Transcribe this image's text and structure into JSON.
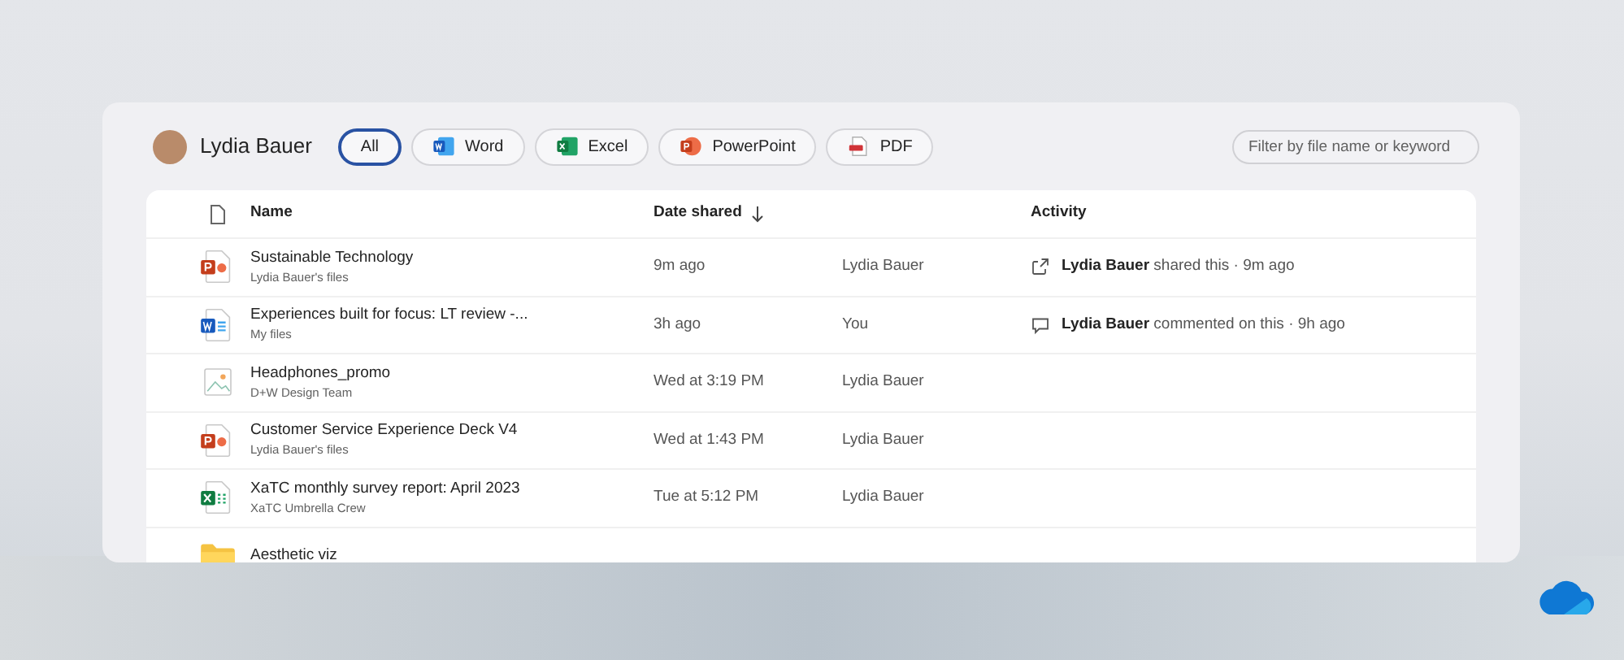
{
  "header": {
    "user_name": "Lydia Bauer"
  },
  "filters": [
    {
      "label": "All",
      "kind": "all",
      "selected": true
    },
    {
      "label": "Word",
      "kind": "word",
      "selected": false
    },
    {
      "label": "Excel",
      "kind": "excel",
      "selected": false
    },
    {
      "label": "PowerPoint",
      "kind": "powerpoint",
      "selected": false
    },
    {
      "label": "PDF",
      "kind": "pdf",
      "selected": false
    }
  ],
  "search": {
    "placeholder": "Filter by file name or keyword"
  },
  "table": {
    "columns": [
      "Name",
      "Date shared",
      "Activity"
    ],
    "rows": [
      {
        "kind": "powerpoint",
        "name": "Sustainable Technology",
        "location": "Lydia Bauer's files",
        "date": "9m ago",
        "shared_by": "Lydia Bauer",
        "activity": {
          "kind": "share",
          "text": "**Lydia Bauer** shared this · 9m ago"
        }
      },
      {
        "kind": "word",
        "name": "Experiences built for focus: LT review -...",
        "location": "My files",
        "date": "3h ago",
        "shared_by": "You",
        "activity": {
          "kind": "comment",
          "text": "**Lydia Bauer** commented on this · 9h ago"
        }
      },
      {
        "kind": "image",
        "name": "Headphones_promo",
        "location": "D+W Design Team",
        "date": "Wed at 3:19 PM",
        "shared_by": "Lydia Bauer"
      },
      {
        "kind": "powerpoint",
        "name": "Customer Service Experience Deck V4",
        "location": "Lydia Bauer's files",
        "date": "Wed at 1:43 PM",
        "shared_by": "Lydia Bauer"
      },
      {
        "kind": "excel",
        "name": "XaTC monthly survey report: April 2023",
        "location": "XaTC Umbrella Crew",
        "date": "Tue at 5:12 PM",
        "shared_by": "Lydia Bauer"
      },
      {
        "kind": "folder",
        "name": "Aesthetic viz"
      }
    ]
  }
}
